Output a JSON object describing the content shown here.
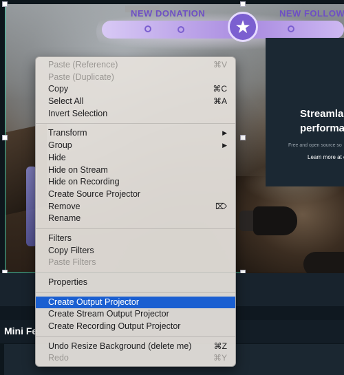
{
  "preview": {
    "banner_left": "NEW DONATION",
    "banner_right": "NEW FOLLOW",
    "banner_star": "★",
    "panel_title": [
      "Streamla",
      "performa"
    ],
    "panel_sub": "Free and open source so",
    "panel_link": "Learn more at c"
  },
  "docks": {
    "mini_feed_title": "Mini Fe"
  },
  "menu": {
    "items": [
      {
        "label": "Paste (Reference)",
        "shortcut": "⌘V",
        "disabled": true
      },
      {
        "label": "Paste (Duplicate)",
        "shortcut": "",
        "disabled": true
      },
      {
        "label": "Copy",
        "shortcut": "⌘C",
        "disabled": false
      },
      {
        "label": "Select All",
        "shortcut": "⌘A",
        "disabled": false
      },
      {
        "label": "Invert Selection",
        "shortcut": "",
        "disabled": false
      },
      {
        "label": "Transform",
        "submenu": true
      },
      {
        "label": "Group",
        "submenu": true
      },
      {
        "label": "Hide"
      },
      {
        "label": "Hide on Stream"
      },
      {
        "label": "Hide on Recording"
      },
      {
        "label": "Create Source Projector"
      },
      {
        "label": "Remove",
        "shortcut": "⌦"
      },
      {
        "label": "Rename"
      },
      {
        "label": "Filters"
      },
      {
        "label": "Copy Filters"
      },
      {
        "label": "Paste Filters",
        "disabled": true
      },
      {
        "label": "Properties"
      },
      {
        "label": "Create Output Projector",
        "highlight": true
      },
      {
        "label": "Create Stream Output Projector"
      },
      {
        "label": "Create Recording Output Projector"
      },
      {
        "label": "Undo Resize Background (delete me)",
        "shortcut": "⌘Z"
      },
      {
        "label": "Redo",
        "shortcut": "⌘Y",
        "disabled": true
      }
    ],
    "submenu_arrow": "▶"
  },
  "colors": {
    "highlight": "#1a5fd1",
    "selection": "#3fbfa0",
    "banner_purple": "#6e4fc4"
  }
}
